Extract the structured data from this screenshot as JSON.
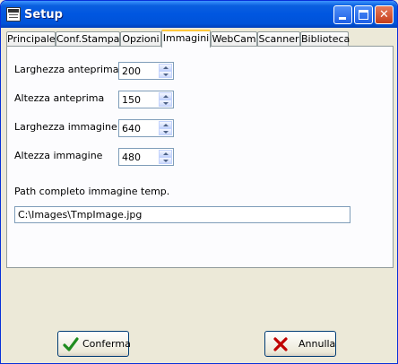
{
  "window": {
    "title": "Setup"
  },
  "tabs": [
    "Principale",
    "Conf.Stampa",
    "Opzioni",
    "Immagini",
    "WebCam",
    "Scanner",
    "Biblioteca"
  ],
  "active_tab": "Immagini",
  "fields": {
    "larghezza_anteprima": {
      "label": "Larghezza anteprima",
      "value": "200"
    },
    "altezza_anteprima": {
      "label": "Altezza anteprima",
      "value": "150"
    },
    "larghezza_immagine": {
      "label": "Larghezza immagine",
      "value": "640"
    },
    "altezza_immagine": {
      "label": "Altezza immagine",
      "value": "480"
    }
  },
  "path": {
    "label": "Path completo immagine temp.",
    "value": "C:\\Images\\TmpImage.jpg"
  },
  "buttons": {
    "confirm": "Conferma",
    "cancel": "Annulla"
  },
  "icons": {
    "confirm": "check-icon",
    "cancel": "x-icon"
  },
  "colors": {
    "titlebar": "#0054e3",
    "confirm_check": "#1f8c1f",
    "cancel_x": "#c00000",
    "active_tab_accent": "#ffc73c"
  }
}
